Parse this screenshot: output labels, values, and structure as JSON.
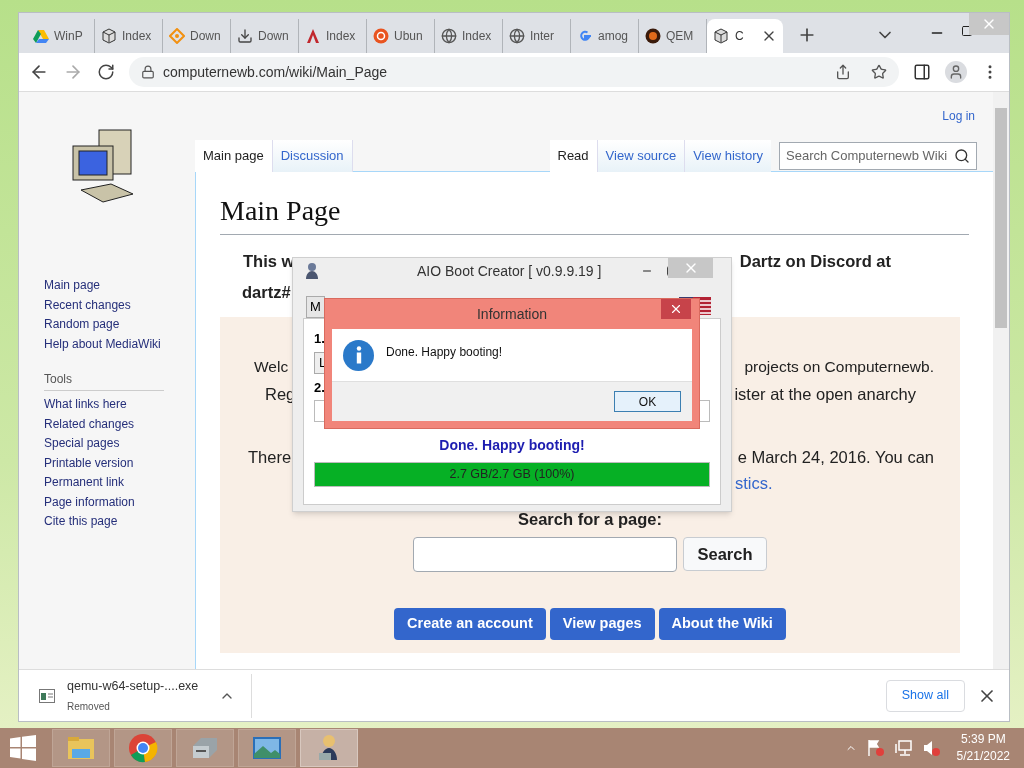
{
  "browser": {
    "tabs": [
      {
        "title": "WinP",
        "kind": "drive",
        "selected": false
      },
      {
        "title": "Index",
        "kind": "cube",
        "selected": false
      },
      {
        "title": "Down",
        "kind": "diamond",
        "selected": false
      },
      {
        "title": "Down",
        "kind": "download",
        "selected": false
      },
      {
        "title": "Index",
        "kind": "arch",
        "selected": false
      },
      {
        "title": "Ubun",
        "kind": "ubuntu",
        "selected": false
      },
      {
        "title": "Index",
        "kind": "globe",
        "selected": false
      },
      {
        "title": "Inter",
        "kind": "globe",
        "selected": false
      },
      {
        "title": "amog",
        "kind": "google",
        "selected": false
      },
      {
        "title": "QEM",
        "kind": "qemu",
        "selected": false
      },
      {
        "title": "C",
        "kind": "cube",
        "selected": true
      }
    ],
    "url": "computernewb.com/wiki/Main_Page"
  },
  "page": {
    "login": "Log in",
    "left_tabs": [
      {
        "label": "Main page",
        "selected": true
      },
      {
        "label": "Discussion",
        "selected": false
      }
    ],
    "right_tabs": [
      {
        "label": "Read",
        "selected": true
      },
      {
        "label": "View source",
        "selected": false
      },
      {
        "label": "View history",
        "selected": false
      }
    ],
    "search_placeholder": "Search Computernewb Wiki",
    "title": "Main Page",
    "notice": {
      "line_1_start": "This w",
      "line_1_end": "Dartz on Discord at",
      "line_2_start": "dartz#"
    },
    "sidebar": {
      "navigation": [
        "Main page",
        "Recent changes",
        "Random page",
        "Help about MediaWiki"
      ],
      "tools_heading": "Tools",
      "tools": [
        "What links here",
        "Related changes",
        "Special pages",
        "Printable version",
        "Permanent link",
        "Page information",
        "Cite this page"
      ]
    },
    "welcome": [
      {
        "start": "Welc",
        "end": "projects on Computernewb."
      },
      {
        "start": "Reg",
        "end": "ister at the open anarchy"
      }
    ],
    "stats": {
      "start": "There",
      "end": "e March 24, 2016. You can",
      "link": "stics."
    },
    "search_label": "Search for a page:",
    "search_button": "Search",
    "buttons": [
      "Create an account",
      "View pages",
      "About the Wiki"
    ]
  },
  "downloads": {
    "file": "qemu-w64-setup-....exe",
    "status": "Removed",
    "show_all": "Show all"
  },
  "aio_window": {
    "title": "AIO Boot Creator [ v0.9.9.19 ]",
    "tab_fragment": "M",
    "step_1": "1.",
    "field_fragment": "L",
    "step_2": "2.",
    "status": "Done. Happy booting!",
    "progress": {
      "level": 1,
      "label": "2.7 GB/2.7 GB (100%)"
    }
  },
  "dialog": {
    "title": "Information",
    "message": "Done. Happy booting!",
    "button": "OK"
  },
  "taskbar": {
    "apps": [
      {
        "kind": "folder",
        "selected": false
      },
      {
        "kind": "chrome",
        "selected": false
      },
      {
        "kind": "drive",
        "selected": false
      },
      {
        "kind": "photo",
        "selected": false
      },
      {
        "kind": "figure",
        "selected": true
      }
    ],
    "time": "5:39 PM",
    "date": "5/21/2022"
  }
}
